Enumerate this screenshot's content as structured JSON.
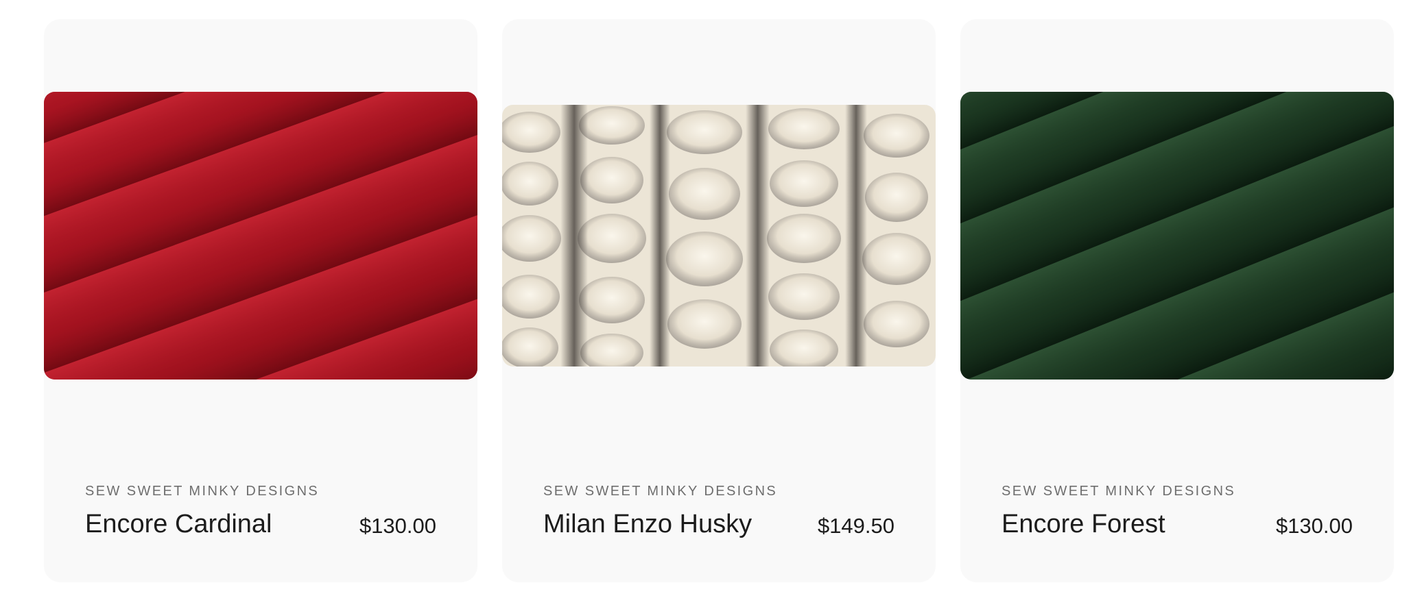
{
  "products": [
    {
      "brand": "SEW SWEET MINKY DESIGNS",
      "title": "Encore Cardinal",
      "price": "$130.00",
      "image": "red plush minky fabric folds",
      "base_color": "#a8141f"
    },
    {
      "brand": "SEW SWEET MINKY DESIGNS",
      "title": "Milan Enzo Husky",
      "price": "$149.50",
      "image": "cream and grey faux fur fabric",
      "base_color": "#e9e2d3"
    },
    {
      "brand": "SEW SWEET MINKY DESIGNS",
      "title": "Encore Forest",
      "price": "$130.00",
      "image": "dark green plush minky fabric folds",
      "base_color": "#1d3a22"
    }
  ]
}
